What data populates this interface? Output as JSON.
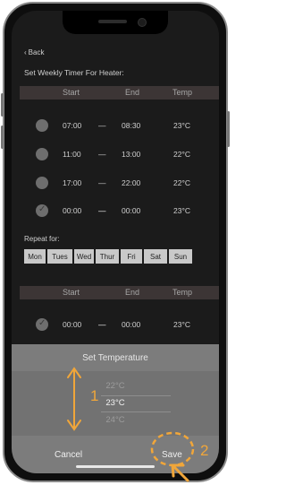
{
  "nav": {
    "back_label": "Back",
    "back_icon": "chevron-left-icon"
  },
  "page": {
    "title": "Set Weekly Timer For Heater:"
  },
  "table_header": {
    "start": "Start",
    "end": "End",
    "temp": "Temp"
  },
  "timers": [
    {
      "start": "07:00",
      "dash": "—",
      "end": "08:30",
      "temp": "23°C",
      "checked": false
    },
    {
      "start": "11:00",
      "dash": "—",
      "end": "13:00",
      "temp": "22°C",
      "checked": false
    },
    {
      "start": "17:00",
      "dash": "—",
      "end": "22:00",
      "temp": "22°C",
      "checked": false
    },
    {
      "start": "00:00",
      "dash": "—",
      "end": "00:00",
      "temp": "23°C",
      "checked": true
    }
  ],
  "repeat": {
    "label": "Repeat for:",
    "days": [
      "Mon",
      "Tues",
      "Wed",
      "Thur",
      "Fri",
      "Sat",
      "Sun"
    ]
  },
  "table_header_2": {
    "start": "Start",
    "end": "End",
    "temp": "Temp"
  },
  "timer_2": {
    "start": "00:00",
    "dash": "—",
    "end": "00:00",
    "temp": "23°C",
    "checked": true
  },
  "sheet": {
    "title": "Set Temperature",
    "options": [
      "22°C",
      "23°C",
      "24°C"
    ],
    "selected_index": 1,
    "cancel_label": "Cancel",
    "save_label": "Save"
  },
  "annotations": {
    "step1": "1",
    "step2": "2",
    "accent_color": "#f0a63a"
  },
  "colors": {
    "screen_bg": "#1b1b1b",
    "header_bg": "#3c3535",
    "sheet_bg": "#7c7c7c",
    "day_bg": "#c9c9c9"
  }
}
